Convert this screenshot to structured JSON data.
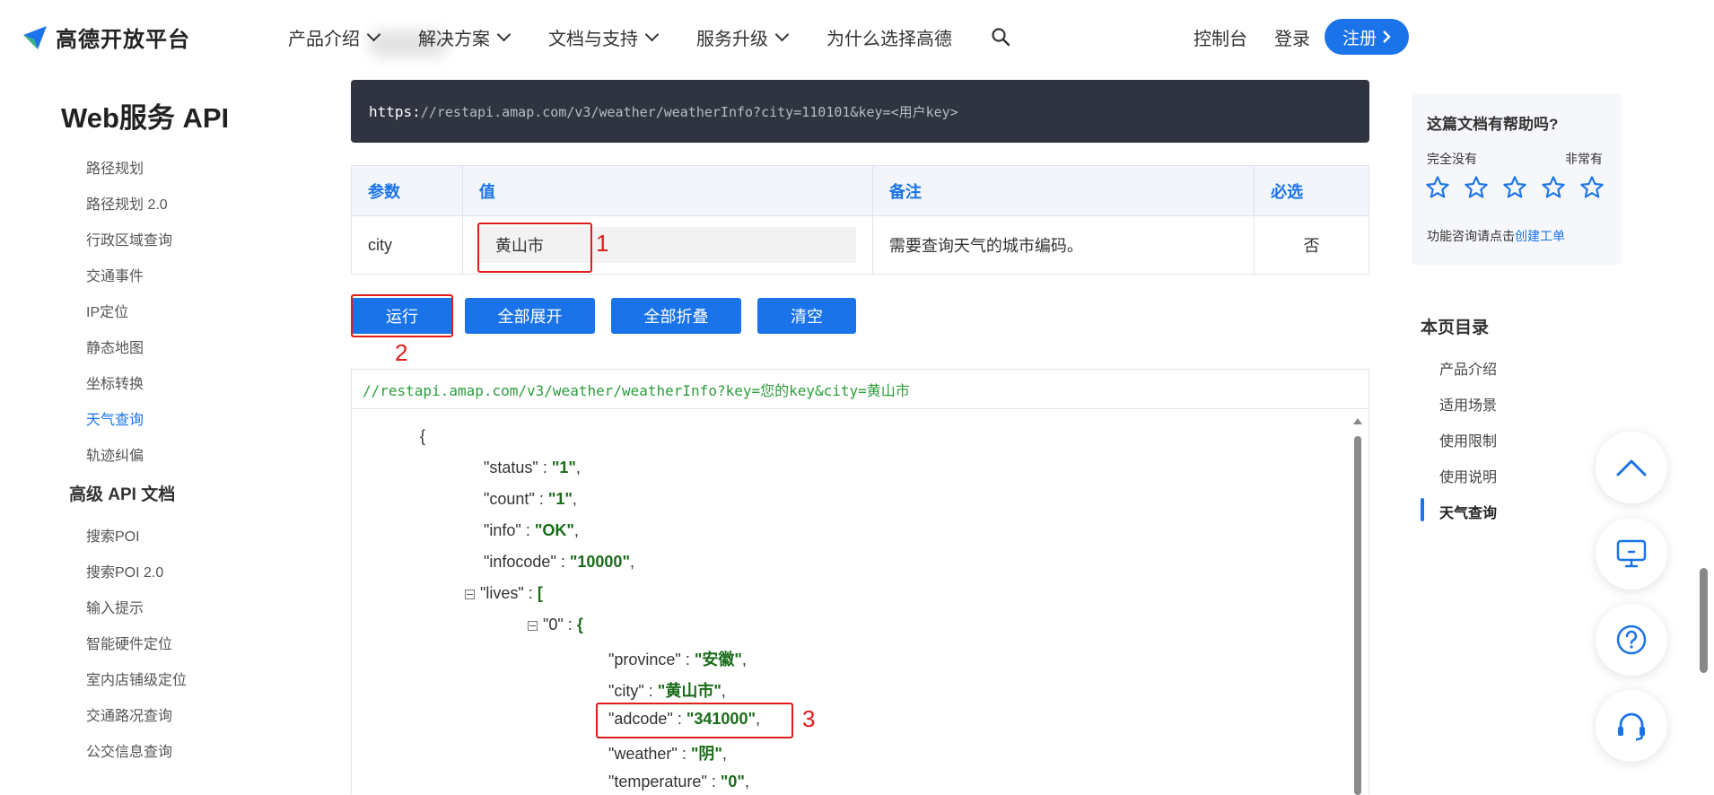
{
  "header": {
    "logo_text": "高德开放平台",
    "nav": [
      "产品介绍",
      "解决方案",
      "文档与支持",
      "服务升级",
      "为什么选择高德"
    ],
    "console": "控制台",
    "login": "登录",
    "register": "注册",
    "brand_color": "#1a73e8"
  },
  "sidebar": {
    "title": "Web服务 API",
    "items": [
      "路径规划",
      "路径规划 2.0",
      "行政区域查询",
      "交通事件",
      "IP定位",
      "静态地图",
      "坐标转换",
      "天气查询",
      "轨迹纠偏"
    ],
    "active": "天气查询",
    "section": "高级 API 文档",
    "advanced_items": [
      "搜索POI",
      "搜索POI 2.0",
      "输入提示",
      "智能硬件定位",
      "室内店铺级定位",
      "交通路况查询",
      "公交信息查询"
    ]
  },
  "main": {
    "code_prefix": "https:",
    "code_url": "//restapi.amap.com/v3/weather/weatherInfo?city=110101&key=<用户key>",
    "table": {
      "headers": [
        "参数",
        "值",
        "备注",
        "必选"
      ],
      "row": {
        "param": "city",
        "value": "黄山市",
        "note": "需要查询天气的城市编码。",
        "required": "否"
      }
    },
    "buttons": {
      "run": "运行",
      "expand": "全部展开",
      "collapse": "全部折叠",
      "clear": "清空"
    },
    "request_url": "//restapi.amap.com/v3/weather/weatherInfo?key=您的key&city=黄山市",
    "json": {
      "open_brace": "{",
      "status_key": "\"status\"",
      "status_val": "\"1\"",
      "count_key": "\"count\"",
      "count_val": "\"1\"",
      "info_key": "\"info\"",
      "info_val": "\"OK\"",
      "infocode_key": "\"infocode\"",
      "infocode_val": "\"10000\"",
      "lives_key": "\"lives\"",
      "lives_open": "[",
      "item0_key": "\"0\"",
      "item0_open": "{",
      "province_key": "\"province\"",
      "province_val": "\"安徽\"",
      "city_key": "\"city\"",
      "city_val": "\"黄山市\"",
      "adcode_key": "\"adcode\"",
      "adcode_val": "\"341000\"",
      "weather_key": "\"weather\"",
      "weather_val": "\"阴\"",
      "temperature_key": "\"temperature\"",
      "temperature_val": "\"0\""
    },
    "annotations": [
      "1",
      "2",
      "3"
    ]
  },
  "help": {
    "title": "这篇文档有帮助吗?",
    "low": "完全没有",
    "high": "非常有",
    "footer": "功能咨询请点击",
    "footer_link": "创建工单"
  },
  "toc": {
    "title": "本页目录",
    "items": [
      "产品介绍",
      "适用场景",
      "使用限制",
      "使用说明",
      "天气查询"
    ],
    "active": "天气查询"
  },
  "floating": [
    "chevron-up-icon",
    "monitor-icon",
    "question-icon",
    "headset-icon"
  ]
}
